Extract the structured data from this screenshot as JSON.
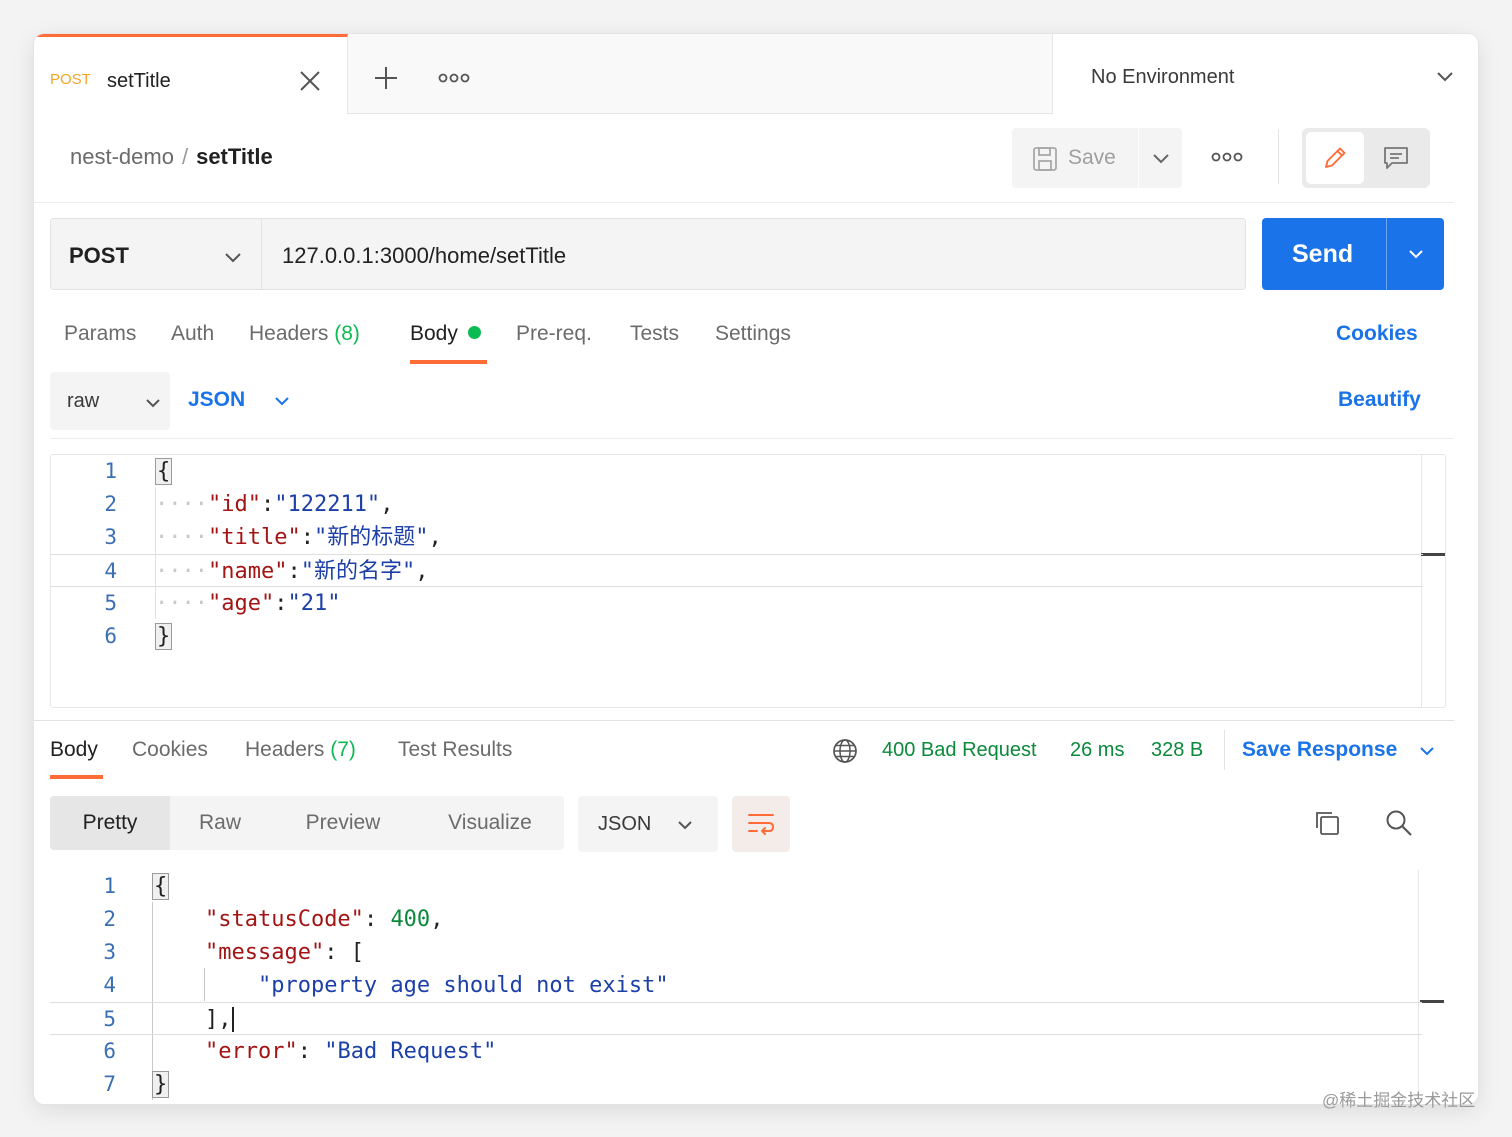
{
  "tab": {
    "method": "POST",
    "name": "setTitle"
  },
  "environment": {
    "label": "No Environment"
  },
  "breadcrumb": {
    "collection": "nest-demo",
    "separator": "/",
    "request": "setTitle"
  },
  "toolbar": {
    "save_label": "Save"
  },
  "request": {
    "method": "POST",
    "url": "127.0.0.1:3000/home/setTitle",
    "send_label": "Send"
  },
  "request_tabs": [
    {
      "label": "Params"
    },
    {
      "label": "Auth"
    },
    {
      "label": "Headers",
      "count": "(8)"
    },
    {
      "label": "Body",
      "active": true,
      "indicator": "green-dot"
    },
    {
      "label": "Pre-req."
    },
    {
      "label": "Tests"
    },
    {
      "label": "Settings"
    }
  ],
  "cookies_label": "Cookies",
  "body_options": {
    "mode": "raw",
    "language": "JSON",
    "beautify_label": "Beautify"
  },
  "request_body": {
    "line_numbers": [
      "1",
      "2",
      "3",
      "4",
      "5",
      "6"
    ],
    "open_brace": "{",
    "close_brace": "}",
    "fields": [
      {
        "key": "\"id\"",
        "value": "\"122211\"",
        "trail": ","
      },
      {
        "key": "\"title\"",
        "value": "\"新的标题\"",
        "trail": ","
      },
      {
        "key": "\"name\"",
        "value": "\"新的名字\"",
        "trail": ","
      },
      {
        "key": "\"age\"",
        "value": "\"21\"",
        "trail": ""
      }
    ]
  },
  "response_tabs": [
    {
      "label": "Body",
      "active": true
    },
    {
      "label": "Cookies"
    },
    {
      "label": "Headers",
      "count": "(7)"
    },
    {
      "label": "Test Results"
    }
  ],
  "response_status": {
    "status": "400 Bad Request",
    "time": "26 ms",
    "size": "328 B",
    "save_label": "Save Response"
  },
  "response_view": {
    "modes": [
      "Pretty",
      "Raw",
      "Preview",
      "Visualize"
    ],
    "active": "Pretty",
    "format": "JSON"
  },
  "response_body": {
    "line_numbers": [
      "1",
      "2",
      "3",
      "4",
      "5",
      "6",
      "7"
    ],
    "open_brace": "{",
    "close_brace": "}",
    "status_key": "\"statusCode\"",
    "status_value": "400",
    "message_key": "\"message\"",
    "message_item": "\"property age should not exist\"",
    "message_close": "],",
    "error_key": "\"error\"",
    "error_value": "\"Bad Request\""
  },
  "colors": {
    "accent": "#ff6c37",
    "primary": "#1a73e8",
    "success": "#0cbb52",
    "status_text": "#0b8a3b",
    "method_post": "#f5a623"
  },
  "icons": [
    "close-icon",
    "plus-icon",
    "more-icon",
    "chevron-down-icon",
    "save-icon",
    "pencil-icon",
    "comment-icon",
    "globe-icon",
    "wrap-icon",
    "copy-icon",
    "search-icon"
  ],
  "watermark": "@稀土掘金技术社区"
}
